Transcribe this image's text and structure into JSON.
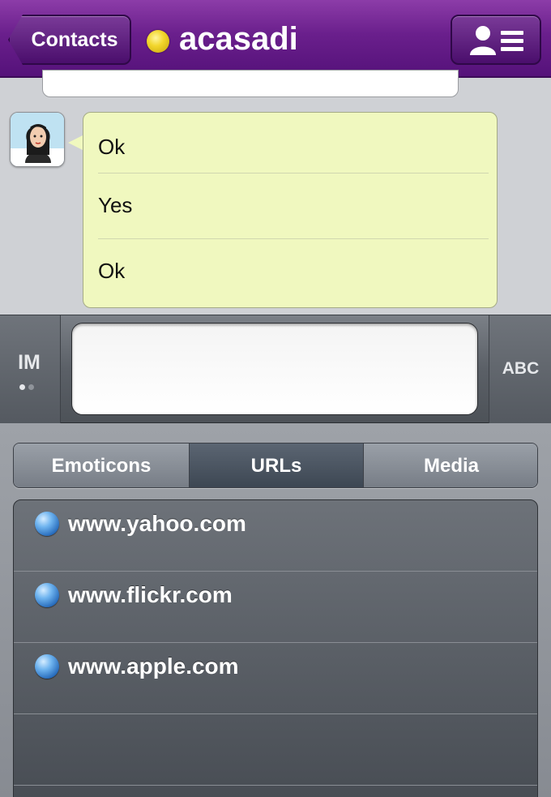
{
  "header": {
    "back_label": "Contacts",
    "username": "acasadi",
    "status_color": "#f2d62c",
    "contact_icon": "contact-list-icon"
  },
  "chat": {
    "messages": [
      "Ok",
      "Yes",
      "Ok"
    ],
    "bubble_color": "#f0f8bf"
  },
  "input": {
    "im_label": "IM",
    "keyboard_label": "ABC",
    "value": ""
  },
  "tabs": [
    {
      "label": "Emoticons",
      "active": false
    },
    {
      "label": "URLs",
      "active": true
    },
    {
      "label": "Media",
      "active": false
    }
  ],
  "urls": [
    "www.yahoo.com",
    "www.flickr.com",
    "www.apple.com"
  ]
}
